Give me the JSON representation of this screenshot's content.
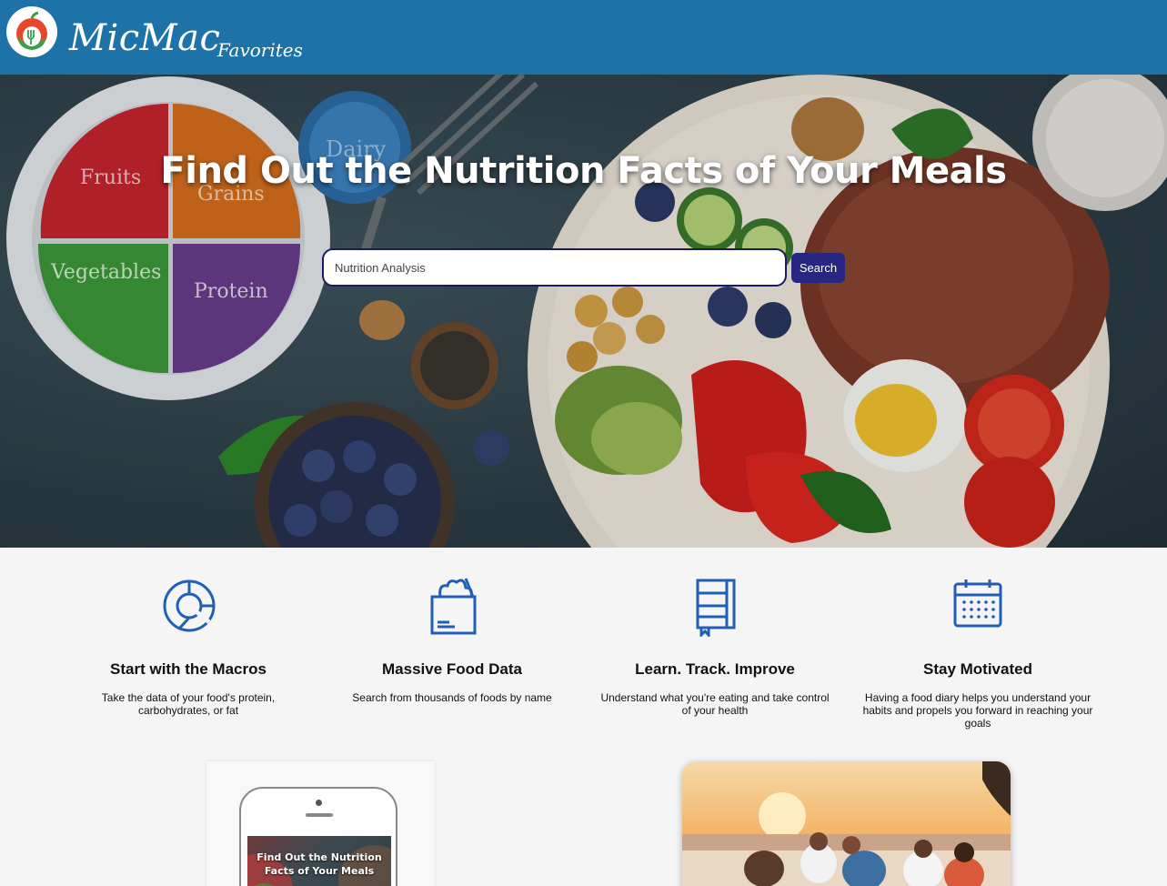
{
  "navbar": {
    "brand": "MicMac",
    "favorites_label": "Favorites",
    "logo_icon": "apple-fork-logo-icon"
  },
  "hero": {
    "title": "Find Out the Nutrition Facts of Your Meals",
    "search_placeholder": "Nutrition Analysis",
    "search_button": "Search"
  },
  "features": [
    {
      "icon": "pie-chart-icon",
      "title": "Start with the Macros",
      "desc": "Take the data of your food's protein, carbohydrates, or fat"
    },
    {
      "icon": "grocery-bag-icon",
      "title": "Massive Food Data",
      "desc": "Search from thousands of foods by name"
    },
    {
      "icon": "notebook-icon",
      "title": "Learn. Track. Improve",
      "desc": "Understand what you're eating and take control of your health"
    },
    {
      "icon": "calendar-icon",
      "title": "Stay Motivated",
      "desc": "Having a food diary helps you understand your habits and propels you forward in reaching your goals"
    }
  ],
  "promo": {
    "phone_screen_text": "Find Out the Nutrition Facts of Your Meals"
  },
  "colors": {
    "navbar": "#1d72a8",
    "search_button": "#272680",
    "icon_blue": "#1f5fb5"
  }
}
